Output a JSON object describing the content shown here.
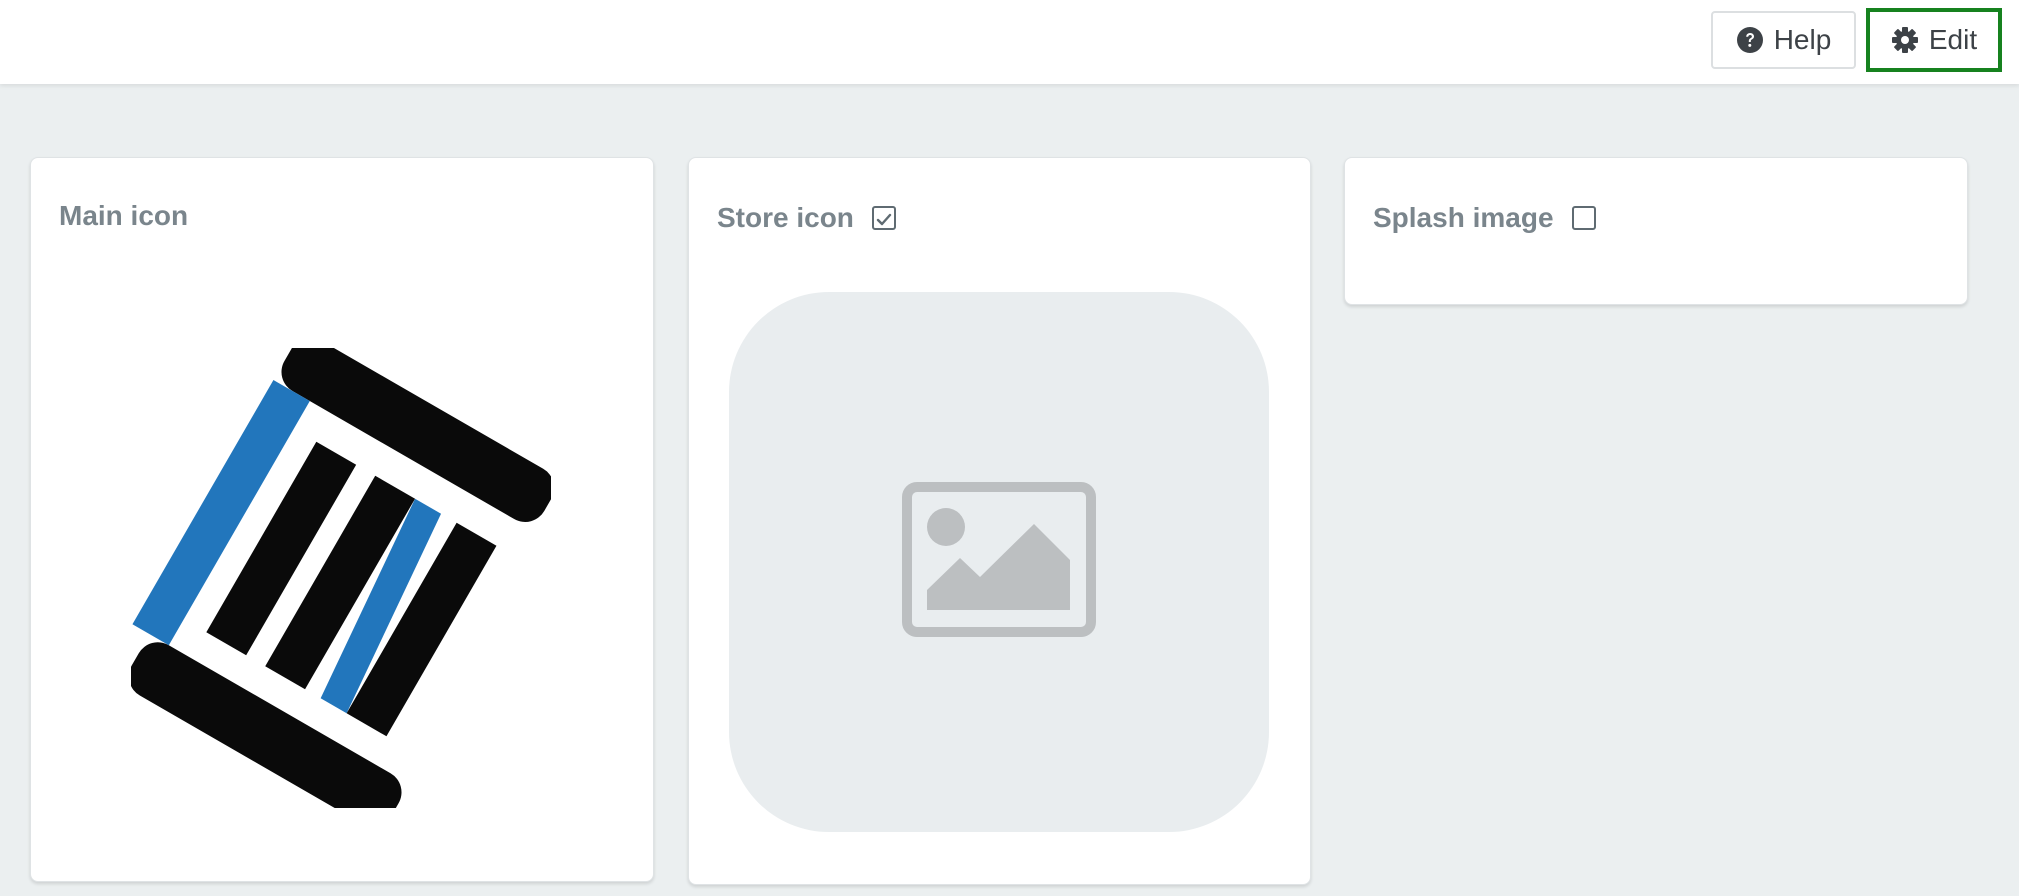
{
  "toolbar": {
    "help_label": "Help",
    "edit_label": "Edit",
    "help_icon": "question-circle-icon",
    "edit_icon": "gear-icon",
    "edit_highlight_color": "#16821f"
  },
  "cards": {
    "main": {
      "title": "Main icon"
    },
    "store": {
      "title": "Store icon",
      "checked": true
    },
    "splash": {
      "title": "Splash image",
      "checked": false
    }
  },
  "colors": {
    "background": "#ebeff0",
    "logo_blue": "#2276bc",
    "logo_black": "#0a0a0a",
    "placeholder_bg": "#e9edef",
    "placeholder_icon": "#bcbfc1"
  }
}
